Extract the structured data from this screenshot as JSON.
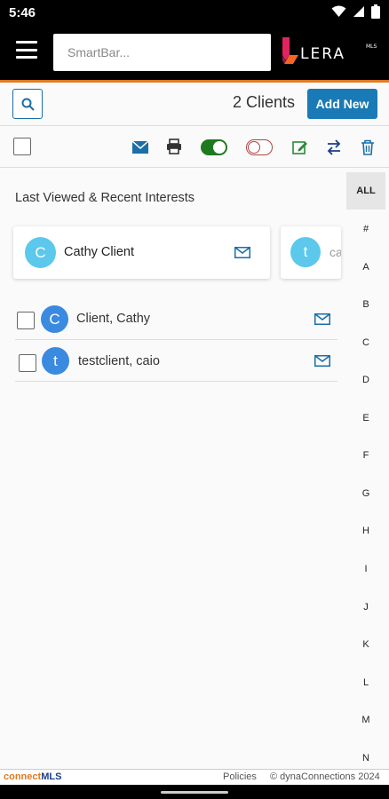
{
  "status_bar": {
    "time": "5:46"
  },
  "header": {
    "smartbar_placeholder": "SmartBar...",
    "logo_text": "LERA",
    "logo_superscript": "MLS"
  },
  "toolbar": {
    "client_count": "2 Clients",
    "add_new_label": "Add New"
  },
  "recent": {
    "title": "Last Viewed & Recent Interests",
    "cards": [
      {
        "initial": "C",
        "name": "Cathy Client"
      },
      {
        "initial": "t",
        "name": "ca"
      }
    ]
  },
  "clients": [
    {
      "initial": "C",
      "name": "Client, Cathy"
    },
    {
      "initial": "t",
      "name": "testclient, caio"
    }
  ],
  "alphabet": {
    "all_label": "ALL",
    "letters": [
      "#",
      "A",
      "B",
      "C",
      "D",
      "E",
      "F",
      "G",
      "H",
      "I",
      "J",
      "K",
      "L",
      "M",
      "N"
    ]
  },
  "footer": {
    "brand_part1": "connect",
    "brand_part2": "MLS",
    "policies": "Policies",
    "copyright": "© dynaConnections 2024"
  },
  "colors": {
    "accent_blue": "#1a7ab5",
    "orange": "#e07a1f",
    "toggle_green": "#1e7a1e",
    "toggle_red": "#b04545",
    "avatar_light": "#5bc8ec",
    "avatar_blue": "#3a8ae0"
  }
}
